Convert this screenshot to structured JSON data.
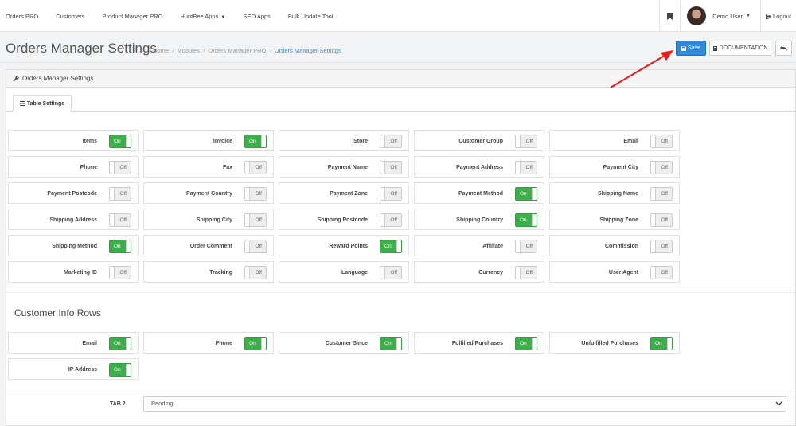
{
  "topnav": {
    "items": [
      "Orders PRO",
      "Customers",
      "Product Manager PRO",
      "HuntBee Apps",
      "SEO Apps",
      "Bulk Update Tool"
    ],
    "user_name": "Demo User",
    "logout": "Logout"
  },
  "header": {
    "title": "Orders Manager Settings",
    "breadcrumb": [
      "Home",
      "Modules",
      "Orders Manager PRO",
      "Orders Manager Settings"
    ],
    "save_label": "Save",
    "doc_label": "DOCUMENTATION"
  },
  "panel": {
    "heading": "Orders Manager Settings",
    "tab_label": "Table Settings"
  },
  "table_fields": [
    {
      "label": "Items",
      "state": "On"
    },
    {
      "label": "Invoice",
      "state": "On"
    },
    {
      "label": "Store",
      "state": "Off"
    },
    {
      "label": "Customer Group",
      "state": "Off"
    },
    {
      "label": "Email",
      "state": "Off"
    },
    {
      "label": "Phone",
      "state": "Off"
    },
    {
      "label": "Fax",
      "state": "Off"
    },
    {
      "label": "Payment Name",
      "state": "Off"
    },
    {
      "label": "Payment Address",
      "state": "Off"
    },
    {
      "label": "Payment City",
      "state": "Off"
    },
    {
      "label": "Payment Postcode",
      "state": "Off"
    },
    {
      "label": "Payment Country",
      "state": "Off"
    },
    {
      "label": "Payment Zone",
      "state": "Off"
    },
    {
      "label": "Payment Method",
      "state": "On"
    },
    {
      "label": "Shipping Name",
      "state": "Off"
    },
    {
      "label": "Shipping Address",
      "state": "Off"
    },
    {
      "label": "Shipping City",
      "state": "Off"
    },
    {
      "label": "Shipping Postcode",
      "state": "Off"
    },
    {
      "label": "Shipping Country",
      "state": "On"
    },
    {
      "label": "Shipping Zone",
      "state": "Off"
    },
    {
      "label": "Shipping Method",
      "state": "On"
    },
    {
      "label": "Order Comment",
      "state": "Off"
    },
    {
      "label": "Reward Points",
      "state": "On"
    },
    {
      "label": "Affiliate",
      "state": "Off"
    },
    {
      "label": "Commission",
      "state": "Off"
    },
    {
      "label": "Marketing ID",
      "state": "Off"
    },
    {
      "label": "Tracking",
      "state": "Off"
    },
    {
      "label": "Language",
      "state": "Off"
    },
    {
      "label": "Currency",
      "state": "Off"
    },
    {
      "label": "User Agent",
      "state": "Off"
    }
  ],
  "customer_section": {
    "title": "Customer Info Rows",
    "fields": [
      {
        "label": "Email",
        "state": "On"
      },
      {
        "label": "Phone",
        "state": "On"
      },
      {
        "label": "Customer Since",
        "state": "On"
      },
      {
        "label": "Fulfilled Purchases",
        "state": "On"
      },
      {
        "label": "Unfulfilled Purchases",
        "state": "On"
      },
      {
        "label": "IP Address",
        "state": "On"
      }
    ]
  },
  "tab2": {
    "label": "TAB 2",
    "value": "Pending"
  },
  "colors": {
    "accent": "#2e8ad8",
    "toggle_on": "#3cae4a",
    "annotation_arrow": "#e8191a"
  }
}
